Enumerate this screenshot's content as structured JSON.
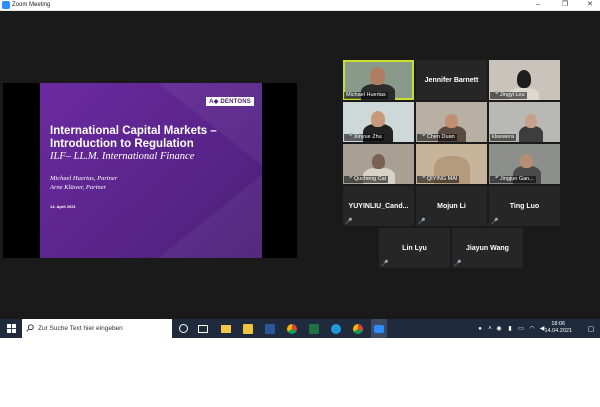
{
  "window": {
    "title": "Zoom Meeting",
    "controls": {
      "minimize": "–",
      "maximize": "❐",
      "close": "✕"
    }
  },
  "slide": {
    "brand": "A◆ DENTONS",
    "title": "International Capital Markets – Introduction to Regulation",
    "subtitle": "ILF– LL.M. International Finance",
    "author1": "Michael Huertas, Partner",
    "author2": "Arne Klüwer, Partner",
    "date": "14. April 2021"
  },
  "participants": [
    {
      "name": "Michael Huertas",
      "video": true,
      "active": true,
      "muted": false
    },
    {
      "name": "Jennifer Barnett",
      "video": false,
      "muted": false
    },
    {
      "name": "Jingyi Lou",
      "video": true,
      "muted": true
    },
    {
      "name": "Xinyue Zhu",
      "video": true,
      "muted": true
    },
    {
      "name": "Chen Duan",
      "video": true,
      "muted": true
    },
    {
      "name": "kluewera",
      "video": true,
      "muted": false
    },
    {
      "name": "Qucheng Cai",
      "video": true,
      "muted": true
    },
    {
      "name": "QIYING MAI",
      "video": true,
      "muted": true
    },
    {
      "name": "Jingjun Gan...",
      "video": true,
      "muted": true
    },
    {
      "name": "YUYINLIU_Cand...",
      "video": false,
      "muted": true
    },
    {
      "name": "Mojun Li",
      "video": false,
      "muted": true
    },
    {
      "name": "Ting Luo",
      "video": false,
      "muted": true
    },
    {
      "name": "Lin Lyu",
      "video": false,
      "muted": true
    },
    {
      "name": "Jiayun Wang",
      "video": false,
      "muted": true
    }
  ],
  "taskbar": {
    "search_placeholder": "Zur Suche Text hier eingeben",
    "time": "18:06",
    "date": "14.04.2021",
    "icons": [
      "windows-start-icon",
      "search-icon",
      "task-view-icon",
      "widgets-icon",
      "file-explorer-icon",
      "outlook-icon",
      "word-icon",
      "chrome-icon",
      "excel-icon",
      "edge-icon",
      "chrome-icon-2",
      "zoom-icon"
    ]
  },
  "colors": {
    "slide_purple": "#582489",
    "active_speaker": "#c8e02c",
    "mute_red": "#e02828",
    "meeting_bg": "#1a1a1a",
    "taskbar_bg": "#1f2b3d"
  }
}
